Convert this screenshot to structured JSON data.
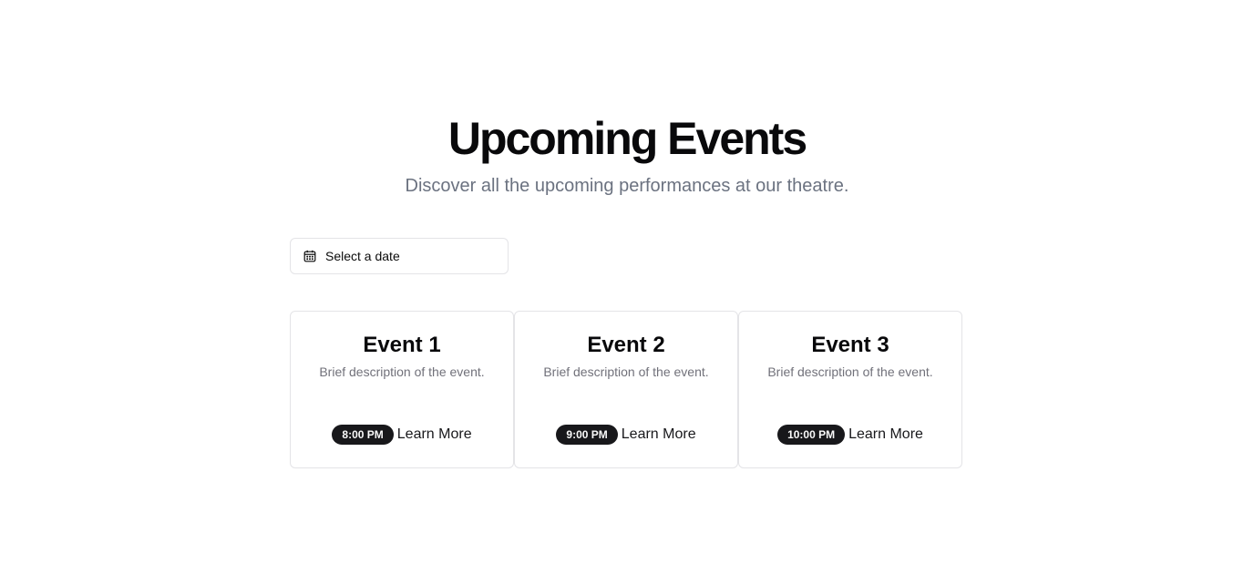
{
  "header": {
    "title": "Upcoming Events",
    "subtitle": "Discover all the upcoming performances at our theatre."
  },
  "date_picker": {
    "icon": "calendar-icon",
    "placeholder": "Select a date"
  },
  "events": [
    {
      "title": "Event 1",
      "description": "Brief description of the event.",
      "time": "8:00 PM",
      "link": "Learn More"
    },
    {
      "title": "Event 2",
      "description": "Brief description of the event.",
      "time": "9:00 PM",
      "link": "Learn More"
    },
    {
      "title": "Event 3",
      "description": "Brief description of the event.",
      "time": "10:00 PM",
      "link": "Learn More"
    }
  ],
  "colors": {
    "text": "#09090b",
    "muted": "#6b7280",
    "border": "#e4e4e7",
    "badge_bg": "#18181b",
    "badge_text": "#fafafa"
  }
}
